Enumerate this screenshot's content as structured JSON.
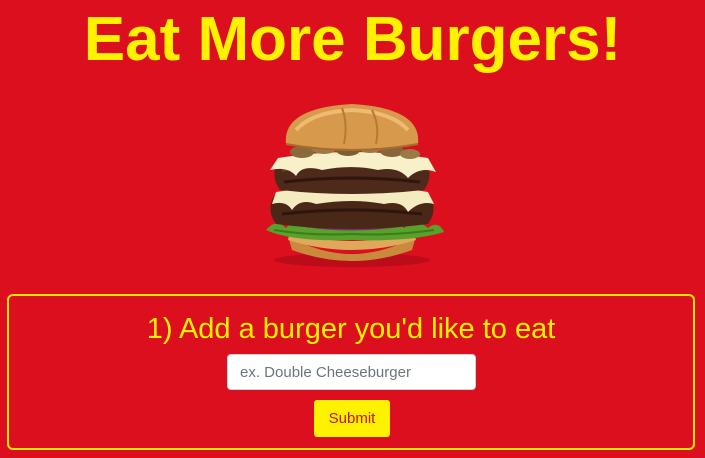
{
  "page": {
    "title": "Eat More Burgers!"
  },
  "hero_image": {
    "icon": "burger-image"
  },
  "add_form": {
    "heading": "1) Add a burger you'd like to eat",
    "input_value": "",
    "input_placeholder": "ex. Double Cheeseburger",
    "submit_label": "Submit"
  },
  "colors": {
    "background": "#dc0f1e",
    "accent_yellow": "#fff200",
    "button_text": "#c8101c"
  }
}
